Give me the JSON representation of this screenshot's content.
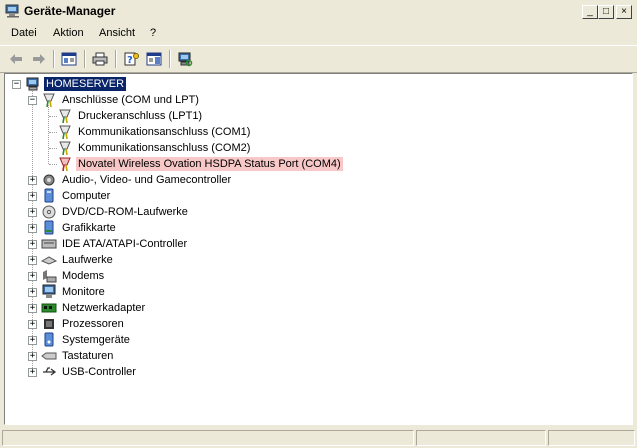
{
  "window": {
    "title": "Geräte-Manager"
  },
  "caption_buttons": {
    "minimize": "_",
    "maximize": "□",
    "close": "×"
  },
  "menu": [
    "Datei",
    "Aktion",
    "Ansicht",
    "?"
  ],
  "toolbar": [
    "back-arrow-icon",
    "forward-arrow-icon",
    "properties-view-icon",
    "print-icon",
    "help-icon",
    "view-icon",
    "scan-hardware-icon"
  ],
  "tree": {
    "root": "HOMESERVER",
    "ports_group": {
      "label": "Anschlüsse (COM und LPT)",
      "children": [
        "Druckeranschluss (LPT1)",
        "Kommunikationsanschluss (COM1)",
        "Kommunikationsanschluss (COM2)",
        "Novatel Wireless Ovation HSDPA Status Port (COM4)"
      ]
    },
    "categories": [
      "Audio-, Video- und Gamecontroller",
      "Computer",
      "DVD/CD-ROM-Laufwerke",
      "Grafikkarte",
      "IDE ATA/ATAPI-Controller",
      "Laufwerke",
      "Modems",
      "Monitore",
      "Netzwerkadapter",
      "Prozessoren",
      "Systemgeräte",
      "Tastaturen",
      "USB-Controller"
    ]
  },
  "expander": {
    "plus": "+",
    "minus": "−"
  }
}
